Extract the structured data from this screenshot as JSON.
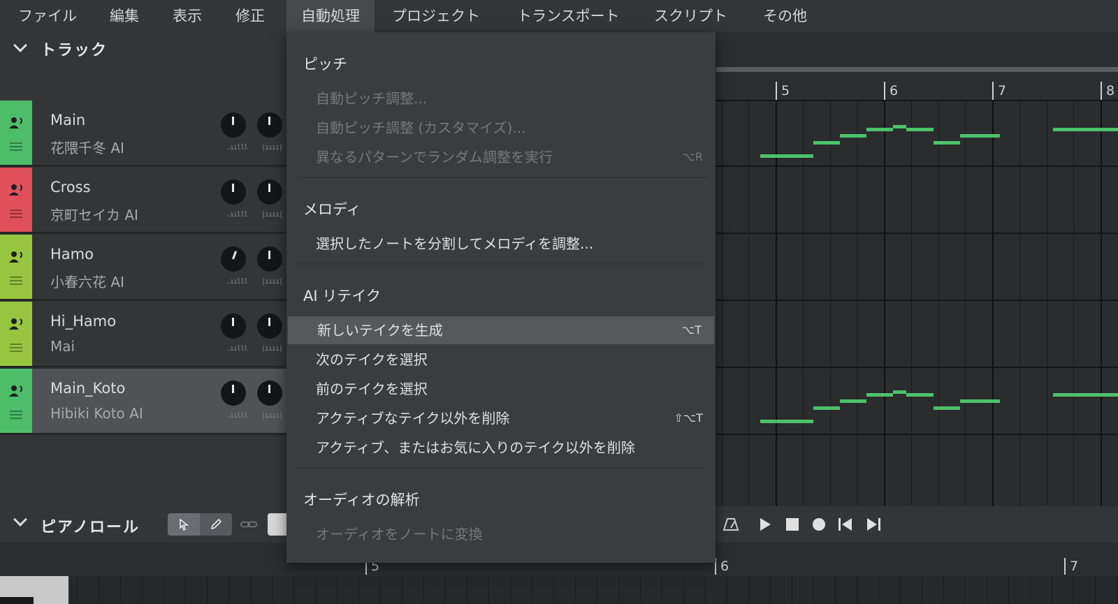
{
  "menubar": {
    "items": [
      {
        "label": "ファイル",
        "active": false
      },
      {
        "label": "編集",
        "active": false
      },
      {
        "label": "表示",
        "active": false
      },
      {
        "label": "修正",
        "active": false
      },
      {
        "label": "自動処理",
        "active": true
      },
      {
        "label": "プロジェクト",
        "active": false
      },
      {
        "label": "トランスポート",
        "active": false
      },
      {
        "label": "スクリプト",
        "active": false
      },
      {
        "label": "その他",
        "active": false
      }
    ]
  },
  "tracks_panel": {
    "title": "トラック",
    "tracks": [
      {
        "name": "Main",
        "voice": "花隈千冬 AI",
        "color": "#4dbd69",
        "selected": false
      },
      {
        "name": "Cross",
        "voice": "京町セイカ AI",
        "color": "#e0505a",
        "selected": false
      },
      {
        "name": "Hamo",
        "voice": "小春六花 AI",
        "color": "#98c53f",
        "selected": false
      },
      {
        "name": "Hi_Hamo",
        "voice": "Mai",
        "color": "#98c53f",
        "selected": false
      },
      {
        "name": "Main_Koto",
        "voice": "Hibiki Koto AI",
        "color": "#4dbd69",
        "selected": true
      }
    ]
  },
  "timeline": {
    "bar_markers": [
      "5",
      "6",
      "7",
      "8"
    ],
    "note_color": "#4cc26a"
  },
  "piano_roll": {
    "title": "ピアノロール",
    "bar_markers": [
      "5",
      "6",
      "7"
    ]
  },
  "auto_menu": {
    "sections": [
      {
        "title": "ピッチ",
        "items": [
          {
            "label": "自動ピッチ調整...",
            "shortcut": "",
            "disabled": true,
            "highlighted": false
          },
          {
            "label": "自動ピッチ調整 (カスタマイズ)...",
            "shortcut": "",
            "disabled": true,
            "highlighted": false
          },
          {
            "label": "異なるパターンでランダム調整を実行",
            "shortcut": "⌥R",
            "disabled": true,
            "highlighted": false
          }
        ]
      },
      {
        "title": "メロディ",
        "items": [
          {
            "label": "選択したノートを分割してメロディを調整...",
            "shortcut": "",
            "disabled": false,
            "highlighted": false
          }
        ]
      },
      {
        "title": "AI リテイク",
        "items": [
          {
            "label": "新しいテイクを生成",
            "shortcut": "⌥T",
            "disabled": false,
            "highlighted": true
          },
          {
            "label": "次のテイクを選択",
            "shortcut": "",
            "disabled": false,
            "highlighted": false
          },
          {
            "label": "前のテイクを選択",
            "shortcut": "",
            "disabled": false,
            "highlighted": false
          },
          {
            "label": "アクティブなテイク以外を削除",
            "shortcut": "⇧⌥T",
            "disabled": false,
            "highlighted": false
          },
          {
            "label": "アクティブ、またはお気に入りのテイク以外を削除",
            "shortcut": "",
            "disabled": false,
            "highlighted": false
          }
        ]
      },
      {
        "title": "オーディオの解析",
        "items": [
          {
            "label": "オーディオをノートに変換",
            "shortcut": "",
            "disabled": true,
            "highlighted": false
          }
        ]
      }
    ]
  }
}
